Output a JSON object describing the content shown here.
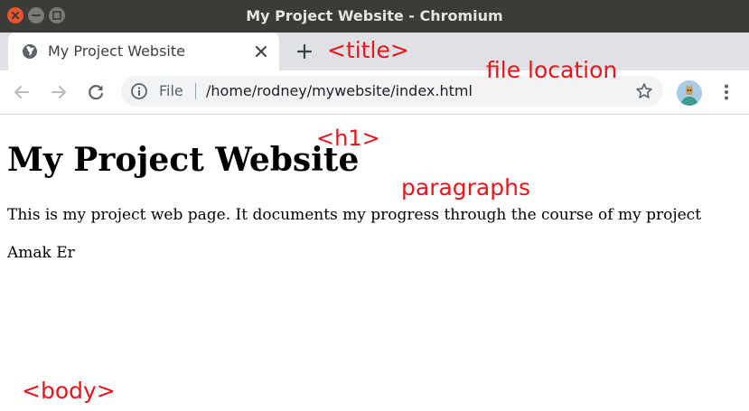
{
  "window": {
    "title": "My Project Website - Chromium"
  },
  "tab": {
    "title": "My Project Website"
  },
  "omnibox": {
    "scheme": "File",
    "url": "/home/rodney/mywebsite/index.html"
  },
  "page": {
    "heading": "My Project Website",
    "paragraphs": [
      "This is my project web page. It documents my progress through the course of my project",
      "Amak Er"
    ]
  },
  "annotations": {
    "title_tag": "<title>",
    "file_location": "file location",
    "h1_tag": "<h1>",
    "paragraphs": "paragraphs",
    "body_tag": "<body>"
  },
  "colors": {
    "annotation": "#e8151b",
    "titlebar": "#3c3b37",
    "close_button": "#e2562e",
    "tabstrip": "#dfe1e5"
  },
  "icons": [
    "close-icon",
    "minimize-icon",
    "maximize-icon",
    "globe-icon",
    "tab-close-icon",
    "plus-icon",
    "back-arrow-icon",
    "forward-arrow-icon",
    "reload-icon",
    "info-icon",
    "star-icon",
    "avatar",
    "kebab-menu-icon"
  ]
}
